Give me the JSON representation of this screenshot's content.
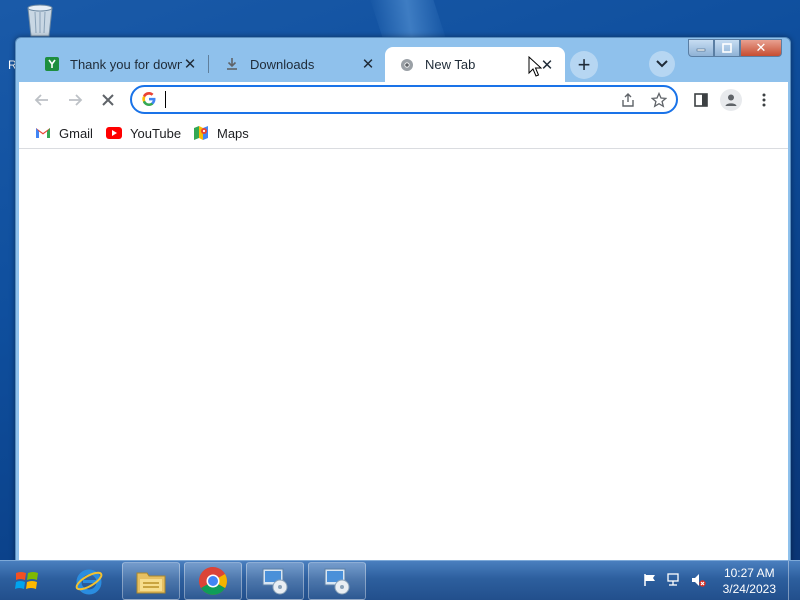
{
  "desktop": {
    "recycle_bin_icon": "recycle-bin-icon",
    "label_stub": "R"
  },
  "tabs": [
    {
      "title": "Thank you for downl",
      "icon": "download-site-icon",
      "active": false
    },
    {
      "title": "Downloads",
      "icon": "download-icon",
      "active": false
    },
    {
      "title": "New Tab",
      "icon": "chrome-icon",
      "active": true
    }
  ],
  "toolbar": {
    "omnibox_value": "",
    "omnibox_placeholder": ""
  },
  "bookmarks": [
    {
      "label": "Gmail",
      "icon": "gmail-icon"
    },
    {
      "label": "YouTube",
      "icon": "youtube-icon"
    },
    {
      "label": "Maps",
      "icon": "maps-icon"
    }
  ],
  "taskbar": {
    "apps": [
      "internet-explorer-icon",
      "file-explorer-icon",
      "chrome-icon",
      "setup-icon",
      "setup-icon"
    ],
    "clock_time": "10:27 AM",
    "clock_date": "3/24/2023"
  },
  "colors": {
    "accent": "#1a73e8",
    "frame": "#8fc1ec",
    "close": "#c74d31"
  }
}
